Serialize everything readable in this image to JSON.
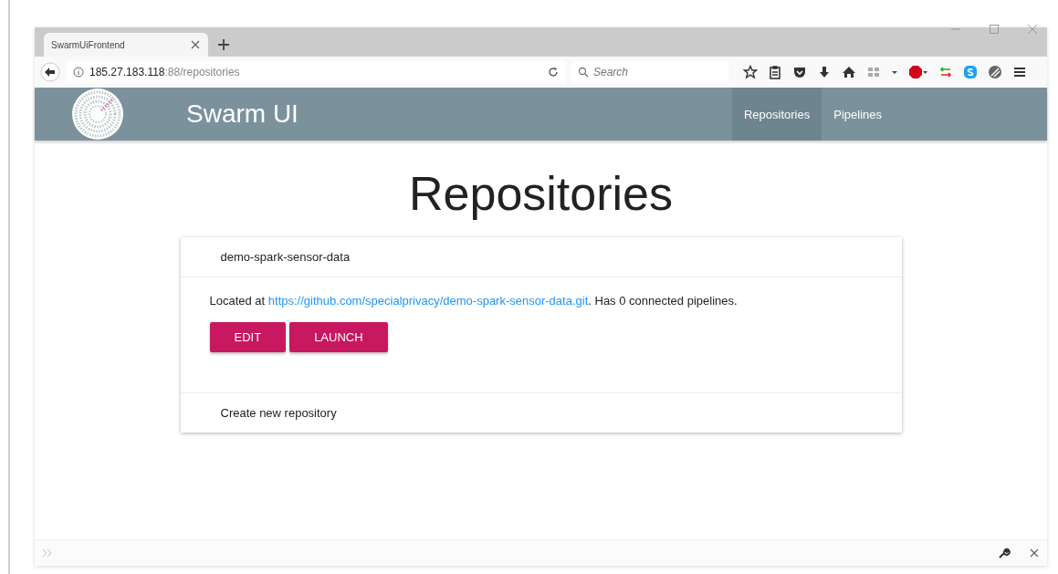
{
  "browser": {
    "tab_title": "SwarmUiFrontend",
    "url_host": "185.27.183.118",
    "url_path": ":88/repositories",
    "search": {
      "placeholder": "Search"
    }
  },
  "app_bar": {
    "title": "Swarm UI",
    "nav": [
      {
        "label": "Repositories",
        "selected": true
      },
      {
        "label": "Pipelines",
        "selected": false
      }
    ]
  },
  "page": {
    "heading": "Repositories",
    "repositories": [
      {
        "name": "demo-spark-sensor-data",
        "text_before": "Located at ",
        "link": "https://github.com/specialprivacy/demo-spark-sensor-data.git",
        "text_after": ". Has 0 connected pipelines.",
        "buttons": [
          "EDIT",
          "LAUNCH"
        ]
      }
    ],
    "create_label": "Create new repository"
  }
}
